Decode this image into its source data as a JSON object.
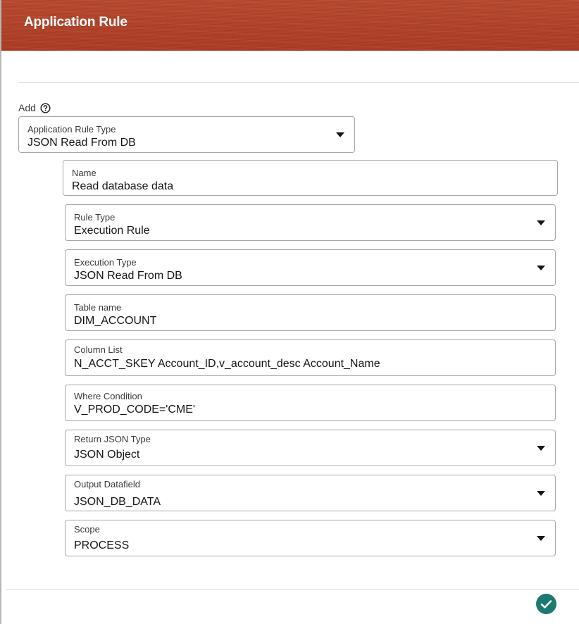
{
  "header": {
    "title": "Application Rule"
  },
  "add": {
    "label": "Add",
    "help_icon": "help-circle-icon"
  },
  "fields": {
    "application_rule_type": {
      "label": "Application Rule Type",
      "value": "JSON Read From DB"
    },
    "name": {
      "label": "Name",
      "value": "Read database data"
    },
    "rule_type": {
      "label": "Rule Type",
      "value": "Execution Rule"
    },
    "execution_type": {
      "label": "Execution Type",
      "value": "JSON Read From DB"
    },
    "table_name": {
      "label": "Table name",
      "value": "DIM_ACCOUNT"
    },
    "column_list": {
      "label": "Column List",
      "value": "N_ACCT_SKEY Account_ID,v_account_desc Account_Name"
    },
    "where_condition": {
      "label": "Where Condition",
      "value": "V_PROD_CODE='CME'"
    },
    "return_json_type": {
      "label": "Return JSON Type",
      "value": "JSON Object"
    },
    "output_datafield": {
      "label": "Output Datafield",
      "value": "JSON_DB_DATA"
    },
    "scope": {
      "label": "Scope",
      "value": "PROCESS"
    }
  },
  "footer": {
    "confirm_icon": "checkmark-icon"
  },
  "colors": {
    "header_bg": "#b4432a",
    "confirm_bg": "#1c7a72",
    "field_border": "#a9a7a3"
  }
}
